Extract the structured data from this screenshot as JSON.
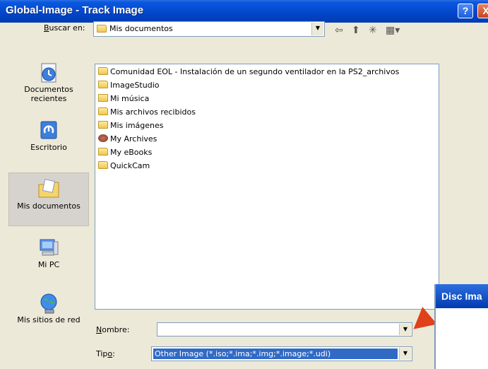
{
  "window": {
    "title": "Global-Image - Track Image",
    "help_label": "?",
    "close_label": "X"
  },
  "lookin": {
    "label_prefix": "",
    "label_u": "B",
    "label_rest": "uscar en:",
    "value": "Mis documentos",
    "arrow": "▼"
  },
  "toolbar": {
    "back": "⇦",
    "up": "⬆",
    "new_folder": "✳",
    "views": "▦▾"
  },
  "places": [
    {
      "label": "Documentos recientes",
      "icon": "recent-documents-icon"
    },
    {
      "label": "Escritorio",
      "icon": "desktop-icon"
    },
    {
      "label": "Mis documentos",
      "icon": "my-documents-icon",
      "selected": true
    },
    {
      "label": "Mi PC",
      "icon": "my-computer-icon"
    },
    {
      "label": "Mis sitios de red",
      "icon": "network-places-icon"
    }
  ],
  "files": [
    {
      "name": "Comunidad EOL - Instalación de un segundo ventilador en la PS2_archivos",
      "icon": "folder-icon"
    },
    {
      "name": "ImageStudio",
      "icon": "folder-icon"
    },
    {
      "name": "Mi música",
      "icon": "music-folder-icon"
    },
    {
      "name": "Mis archivos recibidos",
      "icon": "folder-icon"
    },
    {
      "name": "Mis imágenes",
      "icon": "pictures-folder-icon"
    },
    {
      "name": "My Archives",
      "icon": "archive-icon"
    },
    {
      "name": "My eBooks",
      "icon": "folder-icon"
    },
    {
      "name": "QuickCam",
      "icon": "folder-icon"
    }
  ],
  "filename": {
    "label_u": "N",
    "label_rest": "ombre:",
    "value": "",
    "arrow": "▼"
  },
  "filetype": {
    "label_prefix": "Tip",
    "label_u": "o",
    "label_rest": ":",
    "value": "Other Image (*.iso;*.ima;*.img;*.image;*.udi)",
    "arrow": "▼"
  },
  "popup": {
    "title": "Disc Ima"
  },
  "colors": {
    "titlebar": "#0245c8",
    "selection": "#316ac5",
    "pointer": "#e0401a"
  }
}
